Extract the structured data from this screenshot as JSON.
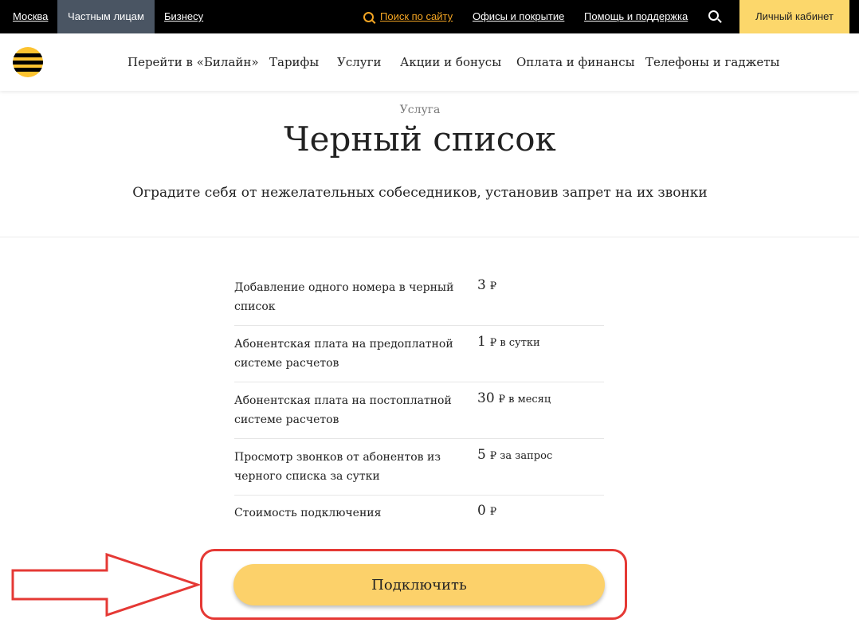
{
  "topbar": {
    "city": "Москва",
    "segments": [
      "Частным лицам",
      "Бизнесу"
    ],
    "search": "Поиск по сайту",
    "offices": "Офисы и покрытие",
    "help": "Помощь и поддержка",
    "cabinet": "Личный кабинет"
  },
  "nav": {
    "items": [
      "Перейти в «Билайн»",
      "Тарифы",
      "Услуги",
      "Акции и бонусы",
      "Оплата и финансы",
      "Телефоны и гаджеты"
    ]
  },
  "hero": {
    "crumb": "Услуга",
    "title": "Черный список",
    "subtitle": "Оградите себя от нежелательных собеседников, установив запрет на их звонки"
  },
  "prices": [
    {
      "label": "Добавление одного номера в черный список",
      "value": "3",
      "unit": "₽"
    },
    {
      "label": "Абонентская плата на предоплатной системе расчетов",
      "value": "1",
      "unit": "₽ в сутки"
    },
    {
      "label": "Абонентская плата на постоплатной системе расчетов",
      "value": "30",
      "unit": "₽ в месяц"
    },
    {
      "label": "Просмотр звонков от абонентов из черного списка за сутки",
      "value": "5",
      "unit": "₽ за запрос"
    },
    {
      "label": "Стоимость подключения",
      "value": "0",
      "unit": "₽"
    }
  ],
  "action": {
    "connect": "Подключить"
  },
  "colors": {
    "brand_yellow": "#fcd16a",
    "accent_orange": "#f5a623",
    "annotation_red": "#e53935"
  }
}
